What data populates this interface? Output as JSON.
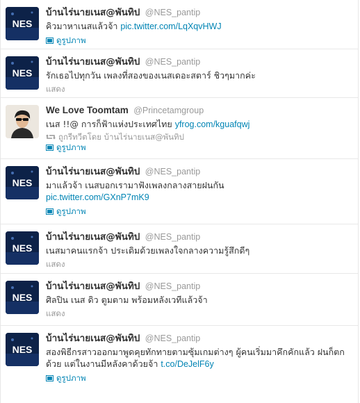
{
  "colors": {
    "link": "#0084b4",
    "muted": "#999999",
    "text": "#333333",
    "avatar_bg": "#0d2248"
  },
  "tweets": [
    {
      "fullname": "บ้านไร่นายเนส@พันทิป",
      "username": "@NES_pantip",
      "text": "คิวมาหาเนสแล้วจ้า ",
      "link": "pic.twitter.com/LqXqvHWJ",
      "action": "ดูรูปภาพ",
      "avatar": "nes-logo-avatar"
    },
    {
      "fullname": "บ้านไร่นายเนส@พันทิป",
      "username": "@NES_pantip",
      "text": "รักเธอไปทุกวัน เพลงที่สองของเนสเดอะสตาร์ ชิวๆมากค่ะ",
      "link": "",
      "action": "แสดง",
      "avatar": "nes-logo-avatar"
    },
    {
      "fullname": "We Love Toomtam",
      "username": "@Princetamgroup",
      "text": "เนส !!@ การก็ฟ้าแห่งประเทศไทย ",
      "link": "yfrog.com/kguafqwj",
      "retweet": "ถูกรีทวีตโดย บ้านไร่นายเนส@พันทิป",
      "action": "ดูรูปภาพ",
      "avatar": "person-avatar"
    },
    {
      "fullname": "บ้านไร่นายเนส@พันทิป",
      "username": "@NES_pantip",
      "text": "มาแล้วจ้า เนสบอกเรามาฟังเพลงกลางสายฝนกัน",
      "link": "pic.twitter.com/GXnP7mK9",
      "action": "ดูรูปภาพ",
      "avatar": "nes-logo-avatar"
    },
    {
      "fullname": "บ้านไร่นายเนส@พันทิป",
      "username": "@NES_pantip",
      "text": "เนสมาคนแรกจ้า ประเดิมด้วยเพลงใจกลางความรู้สึกดีๆ",
      "link": "",
      "action": "แสดง",
      "avatar": "nes-logo-avatar"
    },
    {
      "fullname": "บ้านไร่นายเนส@พันทิป",
      "username": "@NES_pantip",
      "text": "ศิลปิน เนส ดิว ตูมตาม พร้อมหลังเวทีแล้วจ้า",
      "link": "",
      "action": "แสดง",
      "avatar": "nes-logo-avatar"
    },
    {
      "fullname": "บ้านไร่นายเนส@พันทิป",
      "username": "@NES_pantip",
      "text": "สองพิธีกรสาวออกมาพูดคุยทักทายตามซุ้มเกมต่างๆ ผู้คนเริ่มมาคึกคักแล้ว ฝนก็ตกด้วย แต่ในงานมีหลังคาด้วยจ้า ",
      "link": "t.co/DeJelF6y",
      "action": "ดูรูปภาพ",
      "avatar": "nes-logo-avatar"
    }
  ]
}
